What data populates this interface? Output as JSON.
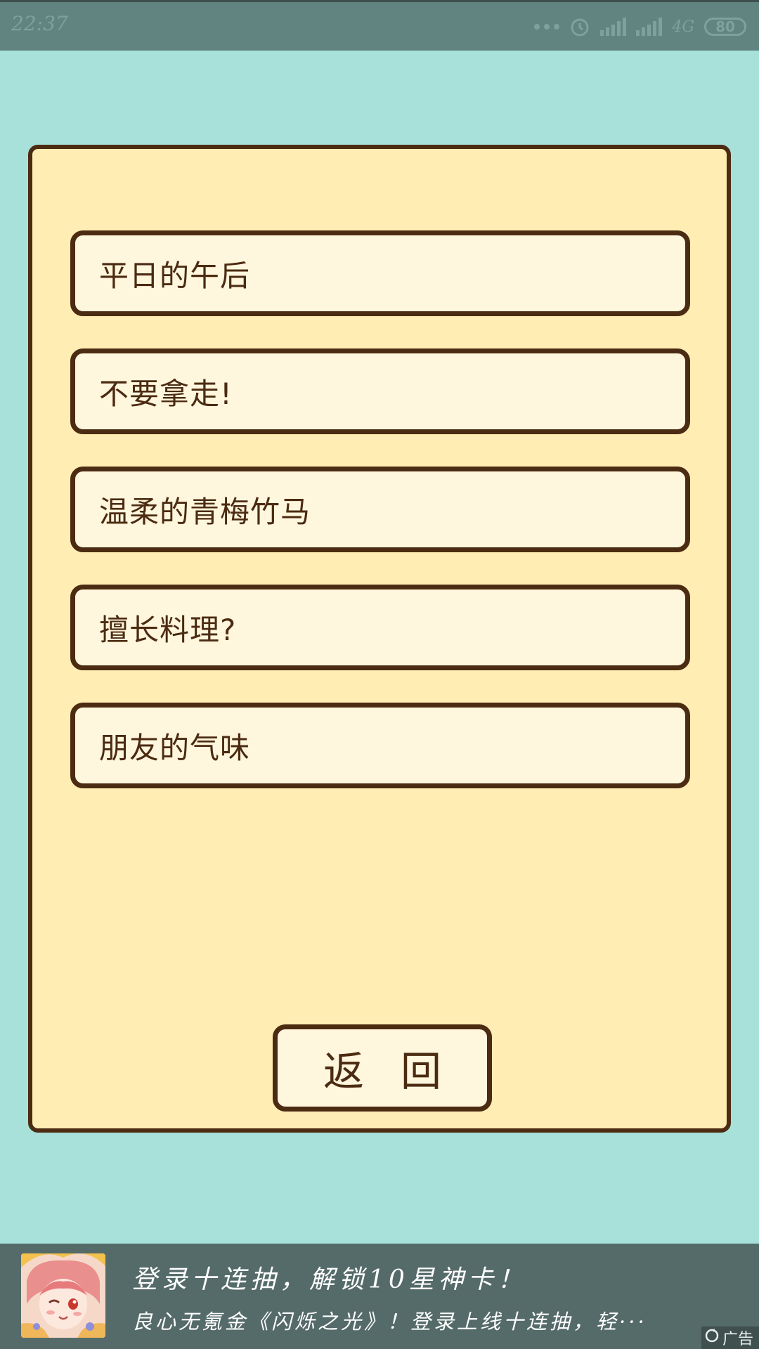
{
  "status_bar": {
    "time": "22:37",
    "network": "4G",
    "battery": "80"
  },
  "menu": {
    "options": [
      {
        "label": "平日的午后"
      },
      {
        "label": "不要拿走!"
      },
      {
        "label": "温柔的青梅竹马"
      },
      {
        "label": "擅长料理?"
      },
      {
        "label": "朋友的气味"
      }
    ],
    "back_label": "返回"
  },
  "ad": {
    "title": "登录十连抽，解锁10星神卡！",
    "description": "良心无氪金《闪烁之光》！登录上线十连抽，轻···",
    "tag": "广告"
  },
  "colors": {
    "background": "#a8e0da",
    "panel": "#ffedb4",
    "button_fill": "#fff6de",
    "outline": "#4b2b11",
    "status_bar": "#628481",
    "ad_bar": "#556b69"
  }
}
